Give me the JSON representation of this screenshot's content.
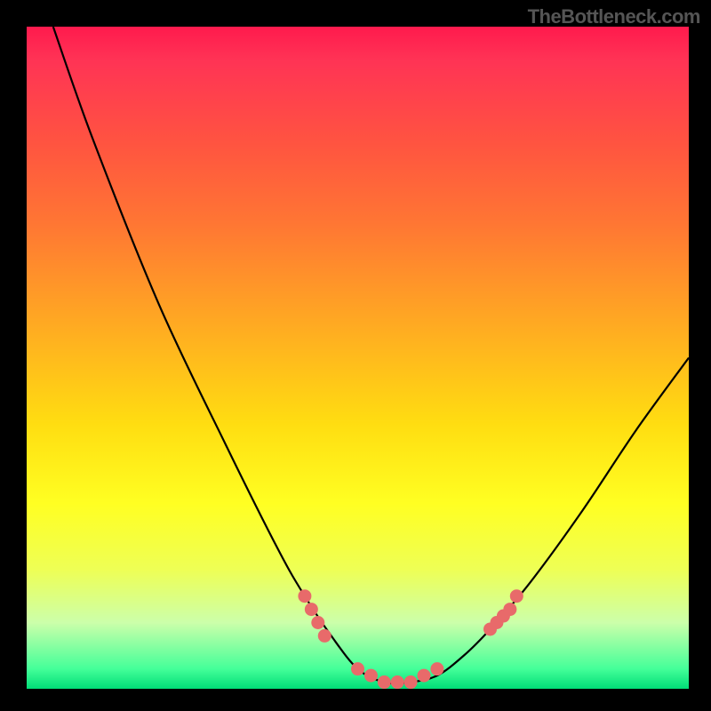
{
  "watermark": "TheBottleneck.com",
  "chart_data": {
    "type": "line",
    "title": "",
    "xlabel": "",
    "ylabel": "",
    "xlim": [
      0,
      100
    ],
    "ylim": [
      0,
      100
    ],
    "series": [
      {
        "name": "bottleneck-curve",
        "x": [
          4,
          10,
          20,
          30,
          38,
          42,
          46,
          50,
          54,
          58,
          62,
          66,
          70,
          76,
          84,
          92,
          100
        ],
        "y": [
          100,
          83,
          58,
          37,
          21,
          14,
          8,
          3,
          1,
          1,
          2,
          5,
          9,
          16,
          27,
          39,
          50
        ]
      }
    ],
    "markers": {
      "name": "highlight-dots",
      "color": "#e86a6a",
      "points": [
        {
          "x": 42,
          "y": 14
        },
        {
          "x": 43,
          "y": 12
        },
        {
          "x": 44,
          "y": 10
        },
        {
          "x": 45,
          "y": 8
        },
        {
          "x": 50,
          "y": 3
        },
        {
          "x": 52,
          "y": 2
        },
        {
          "x": 54,
          "y": 1
        },
        {
          "x": 56,
          "y": 1
        },
        {
          "x": 58,
          "y": 1
        },
        {
          "x": 60,
          "y": 2
        },
        {
          "x": 62,
          "y": 3
        },
        {
          "x": 70,
          "y": 9
        },
        {
          "x": 71,
          "y": 10
        },
        {
          "x": 72,
          "y": 11
        },
        {
          "x": 73,
          "y": 12
        },
        {
          "x": 74,
          "y": 14
        }
      ]
    }
  }
}
